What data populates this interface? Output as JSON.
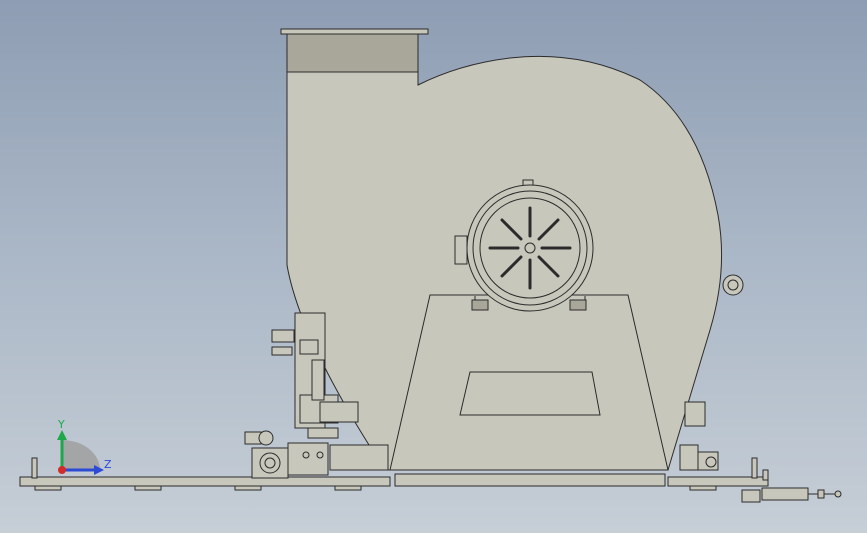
{
  "viewport": {
    "model_name": "",
    "background_top": "#8e9db3",
    "background_bottom": "#c6ced6"
  },
  "part": {
    "body_color": "#c8c7bb",
    "shadow_color": "#a8a79a",
    "line_color": "#2b2b2b"
  },
  "triad": {
    "y_label": "Y",
    "z_label": "Z",
    "y_color": "#1fa84a",
    "z_color": "#2b4bd6",
    "x_color": "#d42a2a"
  }
}
